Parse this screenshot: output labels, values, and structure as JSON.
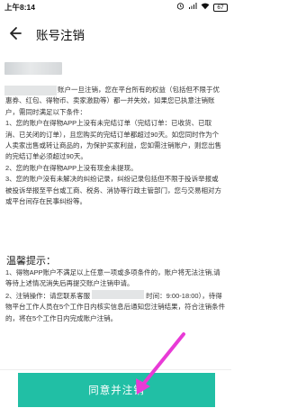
{
  "status_bar": {
    "time": "上午8:14",
    "icons": [
      "alarm-icon",
      "signal-icon",
      "wifi-icon",
      "battery-icon"
    ],
    "battery": "67"
  },
  "nav": {
    "back_icon": "back-arrow-icon",
    "title": "账号注销"
  },
  "content": {
    "intro": "账户一旦注销，您在平台所有的权益（包括但不限于优惠券、红包、得物币、卖家激励等）都一并失效，如果您已执意注销账户，需同时满足以下条件：",
    "cond1": "1、您的账户在得物APP上没有未完结订单（完结订单：已收货、已取消、已关闭的订单），且您购买的完结订单都超过90天。如您同时作为个人卖家出售或转让商品的，为保护买家利益，您如需注销账户，则您出售的完结订单必须超过90天。",
    "cond2": "2、您的账户在得物APP上没有现金未提现。",
    "cond3": "3、您的账户没有未解决的纠纷记录，纠纷记录包括但不限于投诉举报或被投诉举报至平台或工商、税务、消协等行政主管部门，您与交易相对方或平台间存在民事纠纷等。"
  },
  "hint": {
    "title": "温馨提示：",
    "item1": "1、得物APP账户不满足以上任意一项或多项条件的，账户将无法注销,请等待上述情况消失后再提交账户注销申请。",
    "item2_a": "2、注销操作：请您联系客服",
    "item2_b": "时间：9:00-18:00），待得物平台工作人员在5个工作日内核实信息后通知您注销结果，符合注销条件的，将在5个工作日内完成账户注销。"
  },
  "button": {
    "label": "同意并注销"
  },
  "colors": {
    "accent": "#21bfa5",
    "arrow": "#e83ad6"
  }
}
